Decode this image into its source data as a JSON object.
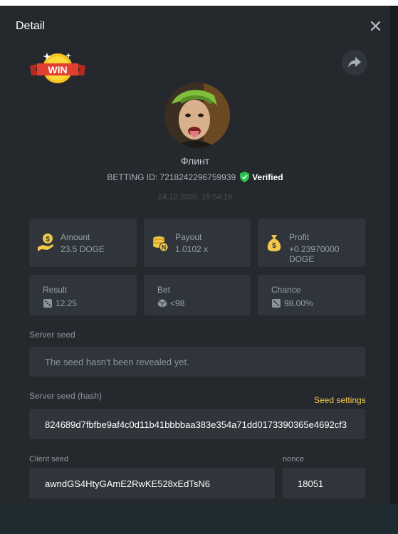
{
  "header": {
    "title": "Detail"
  },
  "badge": {
    "text": "WIN"
  },
  "player": {
    "name": "Флинт",
    "betting_id": "BETTING ID: 7218242296759939",
    "verified": "Verified",
    "timestamp": "24.12.2020, 19:54:19"
  },
  "stats": {
    "amount": {
      "label": "Amount",
      "value": "23.5 DOGE",
      "icon": "coin-hand-icon"
    },
    "payout": {
      "label": "Payout",
      "value": "1.0102 x",
      "icon": "coin-stack-icon"
    },
    "profit": {
      "label": "Profit",
      "value": "+0.23970000 DOGE",
      "icon": "money-bag-icon"
    },
    "result": {
      "label": "Result",
      "value": "12.25"
    },
    "bet": {
      "label": "Bet",
      "value": "<98"
    },
    "chance": {
      "label": "Chance",
      "value": "98.00%"
    }
  },
  "server_seed": {
    "label": "Server seed",
    "value": "The seed hasn't been revealed yet."
  },
  "server_seed_hash": {
    "label": "Server seed (hash)",
    "settings_link": "Seed settings",
    "value": "824689d7fbfbe9af4c0d11b41bbbbaa383e354a71dd0173390365e4692cf3"
  },
  "client_seed": {
    "label": "Client seed",
    "value": "awndGS4HtyGAmE2RwKE528xEdTsN6"
  },
  "nonce": {
    "label": "nonce",
    "value": "18051"
  },
  "colors": {
    "accent": "#f2c94c",
    "verified": "#27c24c",
    "card": "#2f353a",
    "modal": "#25292d"
  }
}
